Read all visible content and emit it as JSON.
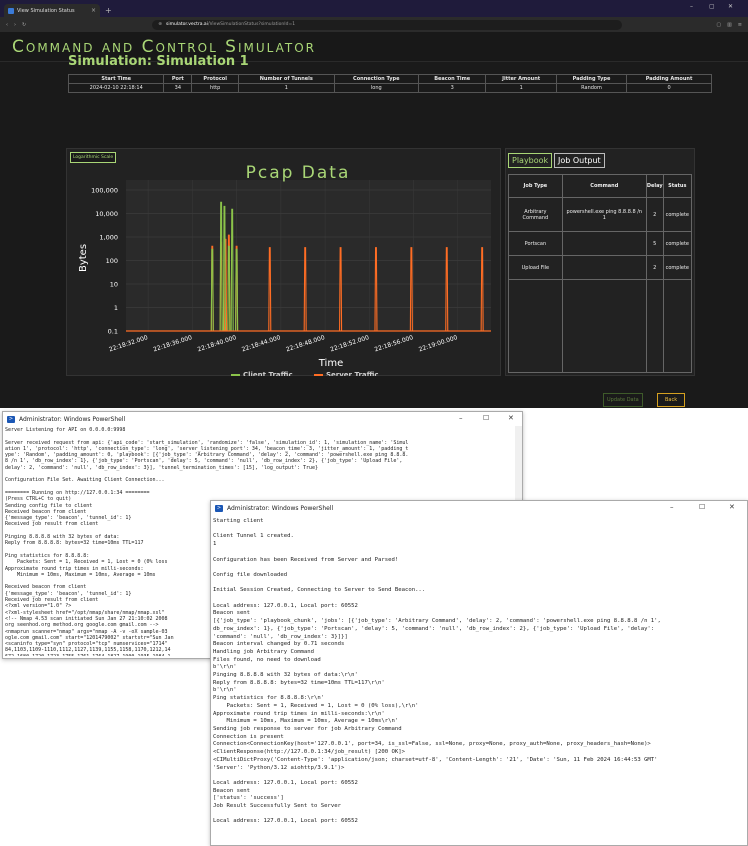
{
  "browser": {
    "tab_title": "View Simulation Status",
    "tab_close": "×",
    "new_tab": "+",
    "url_host": "simulator.vectra.ai",
    "url_path": "/ViewSimulationStatus?simulationId=1",
    "win_min": "–",
    "win_max": "▢",
    "win_close": "✕"
  },
  "app": {
    "title": "Command and Control Simulator",
    "simulation_title": "Simulation: Simulation 1"
  },
  "sim_table": {
    "headers": [
      "Start Time",
      "Port",
      "Protocol",
      "Number of Tunnels",
      "Connection Type",
      "Beacon Time",
      "Jitter Amount",
      "Padding Type",
      "Padding Amount"
    ],
    "row": [
      "2024-02-10 22:18:14",
      "34",
      "http",
      "1",
      "long",
      "3",
      "1",
      "Random",
      "0"
    ]
  },
  "chart_data": {
    "type": "line",
    "title": "Pcap Data",
    "xlabel": "Time",
    "ylabel": "Bytes",
    "log_toggle_label": "Logarithmic Scale",
    "yscale": "log",
    "yticks": [
      "100,000",
      "10,000",
      "1,000",
      "100",
      "10",
      "1",
      "0.1"
    ],
    "ytick_values": [
      100000,
      10000,
      1000,
      100,
      10,
      1,
      0.1
    ],
    "xticks": [
      "22:18:32.000",
      "22:18:36.000",
      "22:18:40.000",
      "22:18:44.000",
      "22:18:48.000",
      "22:18:52.000",
      "22:18:56.000",
      "22:19:00.000"
    ],
    "xrange_seconds": [
      30,
      63
    ],
    "series": [
      {
        "name": "Client Traffic",
        "color": "#8bc34a",
        "spikes": [
          {
            "t": 37.8,
            "v": 300
          },
          {
            "t": 38.6,
            "v": 30000
          },
          {
            "t": 38.9,
            "v": 20000
          },
          {
            "t": 39.3,
            "v": 400
          },
          {
            "t": 39.6,
            "v": 15000
          },
          {
            "t": 40.0,
            "v": 300
          }
        ]
      },
      {
        "name": "Server Traffic",
        "color": "#ff6d24",
        "spikes": [
          {
            "t": 37.8,
            "v": 400
          },
          {
            "t": 38.6,
            "v": 600
          },
          {
            "t": 39.0,
            "v": 800
          },
          {
            "t": 39.3,
            "v": 1200
          },
          {
            "t": 40.0,
            "v": 400
          },
          {
            "t": 43.0,
            "v": 350
          },
          {
            "t": 46.2,
            "v": 350
          },
          {
            "t": 49.4,
            "v": 350
          },
          {
            "t": 52.6,
            "v": 350
          },
          {
            "t": 55.8,
            "v": 350
          },
          {
            "t": 59.0,
            "v": 350
          },
          {
            "t": 62.2,
            "v": 350
          }
        ]
      }
    ]
  },
  "playbook": {
    "tab_playbook": "Playbook",
    "tab_output": "Job Output",
    "headers": [
      "Job Type",
      "Command",
      "Delay",
      "Status"
    ],
    "rows": [
      [
        "Arbitrary Command",
        "powershell.exe ping 8.8.8.8 /n 1",
        "2",
        "complete"
      ],
      [
        "Portscan",
        "",
        "5",
        "complete"
      ],
      [
        "Upload File",
        "",
        "2",
        "complete"
      ]
    ]
  },
  "buttons": {
    "update": "Update Data",
    "back": "Back"
  },
  "ps1": {
    "title": "Administrator: Windows PowerShell",
    "text": "Server Listening for API on 0.0.0.0:9998\n\nServer received request from api: {'api_code': 'start_simulation', 'randomize': 'false', 'simulation_id': 1, 'simulation_name': 'Simul\nation 1', 'protocol': 'http', 'connection_type': 'long', 'server_listening_port': 34, 'beacon_time': 3, 'jitter_amount': 1, 'padding_t\nype': 'Random', 'padding_amount': 0, 'playbook': [{'job_type': 'Arbitrary Command', 'delay': 2, 'command': 'powershell.exe ping 8.8.8.\n8 /n 1', 'db_row_index': 1}, {'job_type': 'Portscan', 'delay': 5, 'command': 'null', 'db_row_index': 2}, {'job_type': 'Upload File',\ndelay': 2, 'command': 'null', 'db_row_index': 3}], 'tunnel_termination_times': [15], 'log_output': True}\n\nConfiguration File Set. Awaiting Client Connection...\n\n======== Running on http://127.0.0.1:34 ========\n(Press CTRL+C to quit)\nSending config file to client\nReceived beacon from client\n{'message_type': 'beacon', 'tunnel_id': 1}\nReceived job result from client\n\nPinging 8.8.8.8 with 32 bytes of data:\nReply from 8.8.8.8: bytes=32 time=10ms TTL=117\n\nPing statistics for 8.8.8.8:\n    Packets: Sent = 1, Received = 1, Lost = 0 (0% loss\nApproximate round trip times in milli-seconds:\n    Minimum = 10ms, Maximum = 10ms, Average = 10ms\n\nReceived beacon from client\n{'message_type': 'beacon', 'tunnel_id': 1}\nReceived job result from client\n<?xml version=\"1.0\" ?>\n<?xml-stylesheet href=\"/opt/nmap/share/nmap/nmap.xsl\"\n<!-- Nmap 4.53 scan initiated Sun Jan 27 21:10:02 2008\norg seenhod.org method.org google.com gmail.com -->\n<nmaprun scanner=\"nmap\" args=\"nmap -A -v -oX sample-03\nogle.com gmail.com\" start=\"1201479002\" startstr=\"Sun Jan\n<scaninfo type=\"syn\" protocol=\"tcp\" numservices=\"1714\"\n84,1103,1109-1110,1112,1127,1139,1155,1158,1170,1212,14\n672,1680,1720,1723,1755,1761-1764,1827,1900,1935,1984,1\n2111-2112,2120-2121,2200,2232,2241,2301,2307,2401,2430,\n,3005-3006,3025,3045,3049,3052,3064,3086,3128,3141,3264\n3,3689,3900,3984-3986,3999-4000,4002,4008,4045,4125,41",
    "min": "–",
    "max": "☐",
    "close": "✕"
  },
  "ps2": {
    "title": "Administrator: Windows PowerShell",
    "text": "Starting client\n\nClient Tunnel 1 created.\n1\n\nConfiguration has been Received from Server and Parsed!\n\nConfig file downloaded\n\nInitial Session Created, Connecting to Server to Send Beacon...\n\nLocal address: 127.0.0.1, Local port: 60552\nBeacon sent\n[{'job_type': 'playbook_chunk', 'jobs': [{'job_type': 'Arbitrary Command', 'delay': 2, 'command': 'powershell.exe ping 8.8.8.8 /n 1',\ndb_row_index': 1}, {'job_type': 'Portscan', 'delay': 5, 'command': 'null', 'db_row_index': 2}, {'job_type': 'Upload File', 'delay':\n'command': 'null', 'db_row_index': 3}]}]\nBeacon interval changed by 0.71 seconds\nHandling job Arbitrary Command\nFiles found, no need to download\nb'\\r\\n'\nPinging 8.8.8.8 with 32 bytes of data:\\r\\n'\nReply from 8.8.8.8: bytes=32 time=10ms TTL=117\\r\\n'\nb'\\r\\n'\nPing statistics for 8.8.8.8:\\r\\n'\n    Packets: Sent = 1, Received = 1, Lost = 0 (0% loss),\\r\\n'\nApproximate round trip times in milli-seconds:\\r\\n'\n    Minimum = 10ms, Maximum = 10ms, Average = 10ms\\r\\n'\nSending job response to server for job Arbitrary Command\nConnection is present\nConnection<ConnectionKey(host='127.0.0.1', port=34, is_ssl=False, ssl=None, proxy=None, proxy_auth=None, proxy_headers_hash=None)>\n<ClientResponse(http://127.0.0.1:34/job_result) [200 OK]>\n<CIMultiDictProxy('Content-Type': 'application/json; charset=utf-8', 'Content-Length': '21', 'Date': 'Sun, 11 Feb 2024 16:44:53 GMT'\n'Server': 'Python/3.12 aiohttp/3.9.1')>\n\nLocal address: 127.0.0.1, Local port: 60552\nBeacon sent\n['status': 'success']\nJob Result Successfully Sent to Server\n\nLocal address: 127.0.0.1, Local port: 60552",
    "min": "–",
    "max": "☐",
    "close": "✕"
  }
}
